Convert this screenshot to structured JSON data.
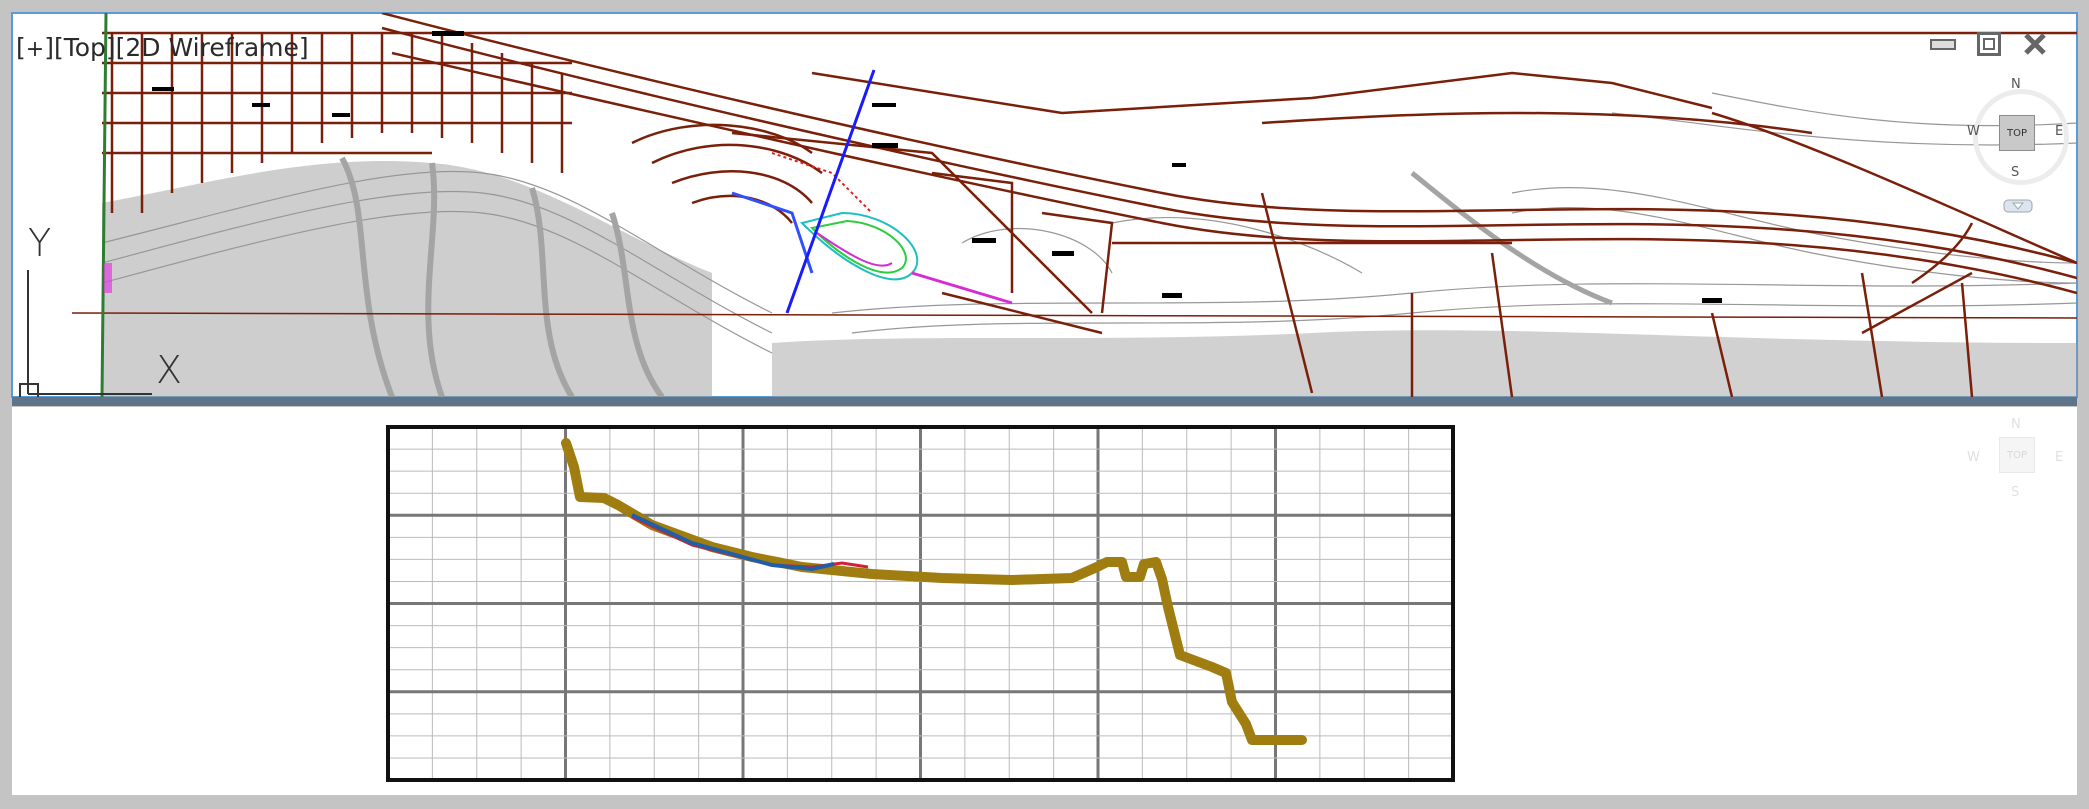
{
  "top_viewport": {
    "label_prefix": "[",
    "label_plus": "+",
    "label_rest": "][Top][2D Wireframe]",
    "viewcube": {
      "face": "TOP",
      "north": "N",
      "south": "S",
      "east": "E",
      "west": "W"
    },
    "ucs_y": "Y",
    "ucs_x": "X",
    "controls": {
      "minimize_icon": "minimize-icon",
      "maximize_icon": "restore-icon",
      "close_icon": "close-icon"
    }
  },
  "bottom_viewport": {
    "viewcube": {
      "face": "TOP",
      "north": "N",
      "south": "S",
      "east": "E",
      "west": "W"
    }
  },
  "colors": {
    "road": "#7a1f0a",
    "contour": "#8a8a8a",
    "profile_existing": "#a07d10",
    "profile_design_blue": "#1f5fa8",
    "profile_design_red": "#d0203a",
    "viewport_border": "#5b9bd5",
    "alignment_blue": "#1a1aff"
  }
}
